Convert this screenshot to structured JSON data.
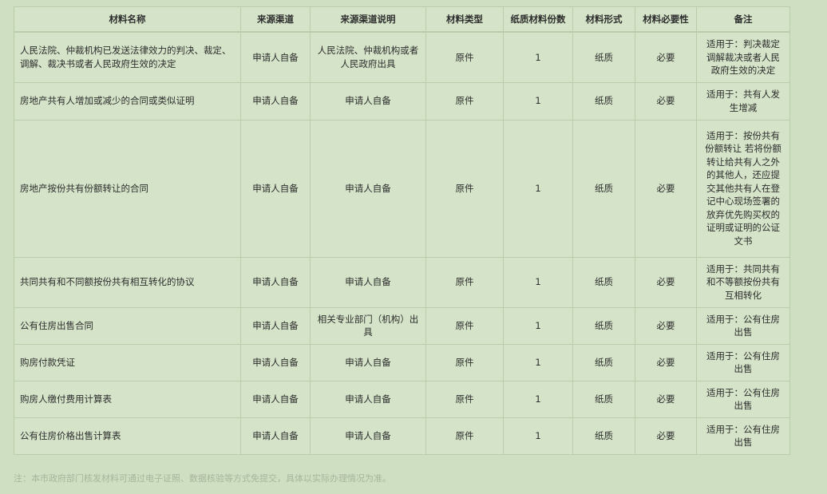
{
  "table": {
    "headers": [
      "材料名称",
      "来源渠道",
      "来源渠道说明",
      "材料类型",
      "纸质材料份数",
      "材料形式",
      "材料必要性",
      "备注"
    ],
    "rows": [
      [
        "人民法院、仲裁机构已发送法律效力的判决、裁定、调解、裁决书或者人民政府生效的决定",
        "申请人自备",
        "人民法院、仲裁机构或者人民政府出具",
        "原件",
        "1",
        "纸质",
        "必要",
        "适用于：判决裁定调解裁决或者人民政府生效的决定"
      ],
      [
        "房地产共有人增加或减少的合同或类似证明",
        "申请人自备",
        "申请人自备",
        "原件",
        "1",
        "纸质",
        "必要",
        "适用于：共有人发生增减"
      ],
      [
        "房地产按份共有份额转让的合同",
        "申请人自备",
        "申请人自备",
        "原件",
        "1",
        "纸质",
        "必要",
        "适用于：按份共有份额转让 若将份额转让给共有人之外的其他人，还应提交其他共有人在登记中心现场签署的放弃优先购买权的证明或证明的公证文书"
      ],
      [
        "共同共有和不同额按份共有相互转化的协议",
        "申请人自备",
        "申请人自备",
        "原件",
        "1",
        "纸质",
        "必要",
        "适用于：共同共有和不等额按份共有互相转化"
      ],
      [
        "公有住房出售合同",
        "申请人自备",
        "相关专业部门（机构）出具",
        "原件",
        "1",
        "纸质",
        "必要",
        "适用于：公有住房出售"
      ],
      [
        "购房付款凭证",
        "申请人自备",
        "申请人自备",
        "原件",
        "1",
        "纸质",
        "必要",
        "适用于：公有住房出售"
      ],
      [
        "购房人缴付费用计算表",
        "申请人自备",
        "申请人自备",
        "原件",
        "1",
        "纸质",
        "必要",
        "适用于：公有住房出售"
      ],
      [
        "公有住房价格出售计算表",
        "申请人自备",
        "申请人自备",
        "原件",
        "1",
        "纸质",
        "必要",
        "适用于：公有住房出售"
      ]
    ]
  },
  "note": "注：本市政府部门核发材料可通过电子证照、数据核验等方式免提交，具体以实际办理情况为准。"
}
